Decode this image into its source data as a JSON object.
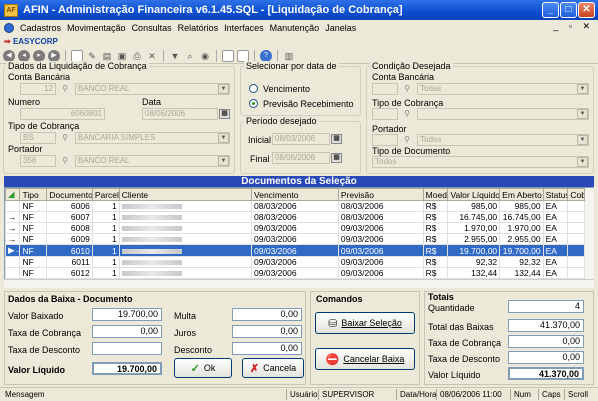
{
  "window": {
    "title": "AFIN - Administração Financeira v6.1.45.SQL - [Liquidação de Cobrança]"
  },
  "menu": [
    "Cadastros",
    "Movimentação",
    "Consultas",
    "Relatórios",
    "Interfaces",
    "Manutenção",
    "Janelas"
  ],
  "mdi_controls": "_ ▫ ✕",
  "brand": "EASYCORP",
  "dados": {
    "title": "Dados da Liquidação de Cobrança",
    "conta_label": "Conta Bancária",
    "conta_code": "12",
    "conta_name": "BANCO REAL",
    "numero_label": "Numero",
    "numero_value": "6060801",
    "data_label": "Data",
    "data_value": "08/06/2006",
    "tipo_label": "Tipo de Cobrança",
    "tipo_code": "BS",
    "tipo_name": "BANCARIA SIMPLES",
    "portador_label": "Portador",
    "portador_code": "356",
    "portador_name": "BANCO REAL"
  },
  "selecionar": {
    "title": "Selecionar por data de",
    "opt1": "Vencimento",
    "opt2": "Previsão Recebimento"
  },
  "periodo": {
    "title": "Período desejado",
    "inicial_label": "Inicial",
    "inicial_value": "08/03/2006",
    "final_label": "Final",
    "final_value": "08/06/2006"
  },
  "condicao": {
    "title": "Condição Desejada",
    "conta_label": "Conta Bancária",
    "conta_value": "Todas",
    "tipo_label": "Tipo de Cobrança",
    "portador_label": "Portador",
    "portador_value": "Todos",
    "tipodoc_label": "Tipo de Documento",
    "tipodoc_value": "Todos"
  },
  "grid": {
    "title": "Documentos da Seleção",
    "columns": [
      "",
      "Tipo",
      "Documento",
      "Parcela",
      "Cliente",
      "Vencimento",
      "Previsão",
      "Moeda",
      "Valor Líquido",
      "Em Aberto",
      "Status",
      "Cob"
    ],
    "rows": [
      {
        "mark": "",
        "tipo": "NF",
        "doc": "6006",
        "parc": "1",
        "venc": "08/03/2006",
        "prev": "08/03/2006",
        "moeda": "R$",
        "valor": "985,00",
        "aberto": "985,00",
        "status": "EA",
        "sel": false
      },
      {
        "mark": "→",
        "tipo": "NF",
        "doc": "6007",
        "parc": "1",
        "venc": "08/03/2006",
        "prev": "08/03/2006",
        "moeda": "R$",
        "valor": "16.745,00",
        "aberto": "16.745,00",
        "status": "EA",
        "sel": false
      },
      {
        "mark": "→",
        "tipo": "NF",
        "doc": "6008",
        "parc": "1",
        "venc": "09/03/2006",
        "prev": "09/03/2006",
        "moeda": "R$",
        "valor": "1.970,00",
        "aberto": "1.970,00",
        "status": "EA",
        "sel": false
      },
      {
        "mark": "→",
        "tipo": "NF",
        "doc": "6009",
        "parc": "1",
        "venc": "09/03/2006",
        "prev": "09/03/2006",
        "moeda": "R$",
        "valor": "2.955,00",
        "aberto": "2.955,00",
        "status": "EA",
        "sel": false
      },
      {
        "mark": "▶→",
        "tipo": "NF",
        "doc": "6010",
        "parc": "1",
        "venc": "09/03/2006",
        "prev": "09/03/2006",
        "moeda": "R$",
        "valor": "19.700,00",
        "aberto": "19.700,00",
        "status": "EA",
        "sel": true
      },
      {
        "mark": "",
        "tipo": "NF",
        "doc": "6011",
        "parc": "1",
        "venc": "09/03/2006",
        "prev": "09/03/2006",
        "moeda": "R$",
        "valor": "92,32",
        "aberto": "92,32",
        "status": "EA",
        "sel": false
      },
      {
        "mark": "",
        "tipo": "NF",
        "doc": "6012",
        "parc": "1",
        "venc": "09/03/2006",
        "prev": "09/03/2006",
        "moeda": "R$",
        "valor": "132,44",
        "aberto": "132,44",
        "status": "EA",
        "sel": false
      }
    ]
  },
  "baixa": {
    "title": "Dados da Baixa - Documento",
    "valor_baixado_label": "Valor Baixado",
    "valor_baixado": "19.700,00",
    "multa_label": "Multa",
    "multa": "0,00",
    "taxa_cob_label": "Taxa de Cobrança",
    "taxa_cob": "0,00",
    "juros_label": "Juros",
    "juros": "0,00",
    "taxa_desc_label": "Taxa de Desconto",
    "desconto_label": "Desconto",
    "desconto": "0,00",
    "valor_liq_label": "Valor Líquido",
    "valor_liq": "19.700,00",
    "ok": "Ok",
    "cancela": "Cancela"
  },
  "comandos": {
    "title": "Comandos",
    "baixar": "Baixar Seleção",
    "cancelar": "Cancelar Baixa"
  },
  "totais": {
    "title": "Totais",
    "quantidade_label": "Quantidade",
    "quantidade": "4",
    "total_label": "Total das Baixas",
    "total": "41.370,00",
    "taxa_cob_label": "Taxa de Cobrança",
    "taxa_cob": "0,00",
    "taxa_desc_label": "Taxa de Desconto",
    "taxa_desc": "0,00",
    "valor_liq_label": "Valor Líquido",
    "valor_liq": "41.370,00"
  },
  "status": {
    "mensagem": "Mensagem",
    "usuario_label": "Usuário",
    "usuario": "SUPERVISOR",
    "datahora_label": "Data/Hora",
    "datahora": "08/06/2006 11:00",
    "num": "Num",
    "caps": "Caps",
    "scroll": "Scroll"
  }
}
